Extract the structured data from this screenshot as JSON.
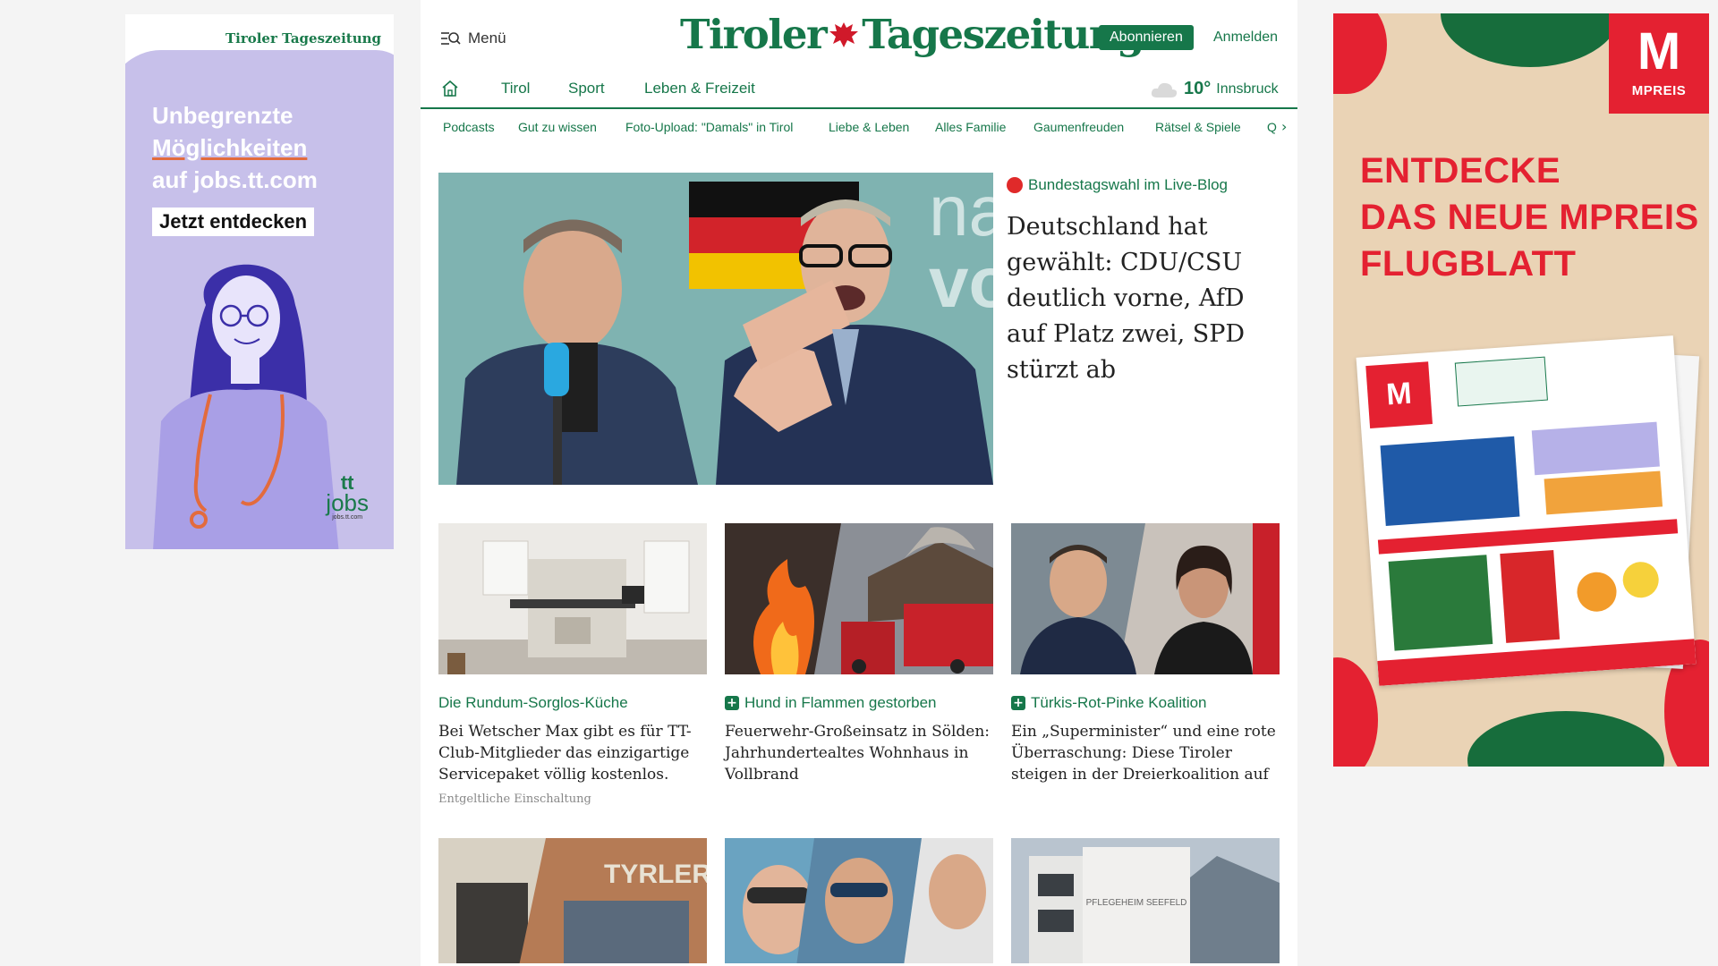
{
  "ad_left": {
    "brand": "Tiroler Tageszeitung",
    "headline_line1": "Unbegrenzte",
    "headline_line2": "Möglichkeiten",
    "headline_line3": "auf jobs.tt.com",
    "cta": "Jetzt entdecken",
    "logo_tt": "tt",
    "logo_jobs": "jobs",
    "logo_url": "jobs.tt.com"
  },
  "ad_right": {
    "brand_letter": "M",
    "brand_name": "MPREIS",
    "headline_line1": "ENTDECKE",
    "headline_line2": "DAS NEUE MPREIS",
    "headline_line3": "FLUGBLATT",
    "colors": {
      "red": "#e42131",
      "green": "#176d3c",
      "beige": "#ead3b5"
    }
  },
  "header": {
    "menu_label": "Menü",
    "brand_left": "Tiroler",
    "brand_right": "Tageszeitung",
    "subscribe_label": "Abonnieren",
    "login_label": "Anmelden"
  },
  "nav": {
    "items": [
      "Tirol",
      "Sport",
      "Leben & Freizeit"
    ],
    "weather_temp": "10°",
    "weather_city": "Innsbruck"
  },
  "subnav": {
    "items": [
      "Podcasts",
      "Gut zu wissen",
      "Foto-Upload: \"Damals\" in Tirol",
      "Liebe & Leben",
      "Alles Familie",
      "Gaumenfreuden",
      "Rätsel & Spiele",
      "Q"
    ]
  },
  "hero": {
    "kicker": "Bundestagswahl im Live-Blog",
    "title": "Deutschland hat gewählt: CDU/CSU deutlich vorne, AfD auf Platz zwei, SPD stürzt ab"
  },
  "cards": [
    {
      "kicker": "Die Rundum-Sorglos-Küche",
      "title": "Bei Wetscher Max gibt es für TT-Club-Mitglieder das einzigartige Servicepaket völlig kostenlos.",
      "note": "Entgeltliche Einschaltung"
    },
    {
      "kicker": "Hund in Flammen gestorben",
      "title": "Feuerwehr-Großeinsatz in Sölden: Jahrhundertealtes Wohnhaus in Vollbrand"
    },
    {
      "kicker": "Türkis-Rot-Pinke Koalition",
      "title": "Ein „Superminister“ und eine rote Überraschung: Diese Tiroler steigen in der Dreierkoalition auf"
    }
  ],
  "row2_images": {
    "shop_sign": "TYRLER",
    "building_sign": "PFLEGEHEIM SEEFELD"
  },
  "colors": {
    "accent": "#16774a",
    "live": "#e02a2a"
  }
}
